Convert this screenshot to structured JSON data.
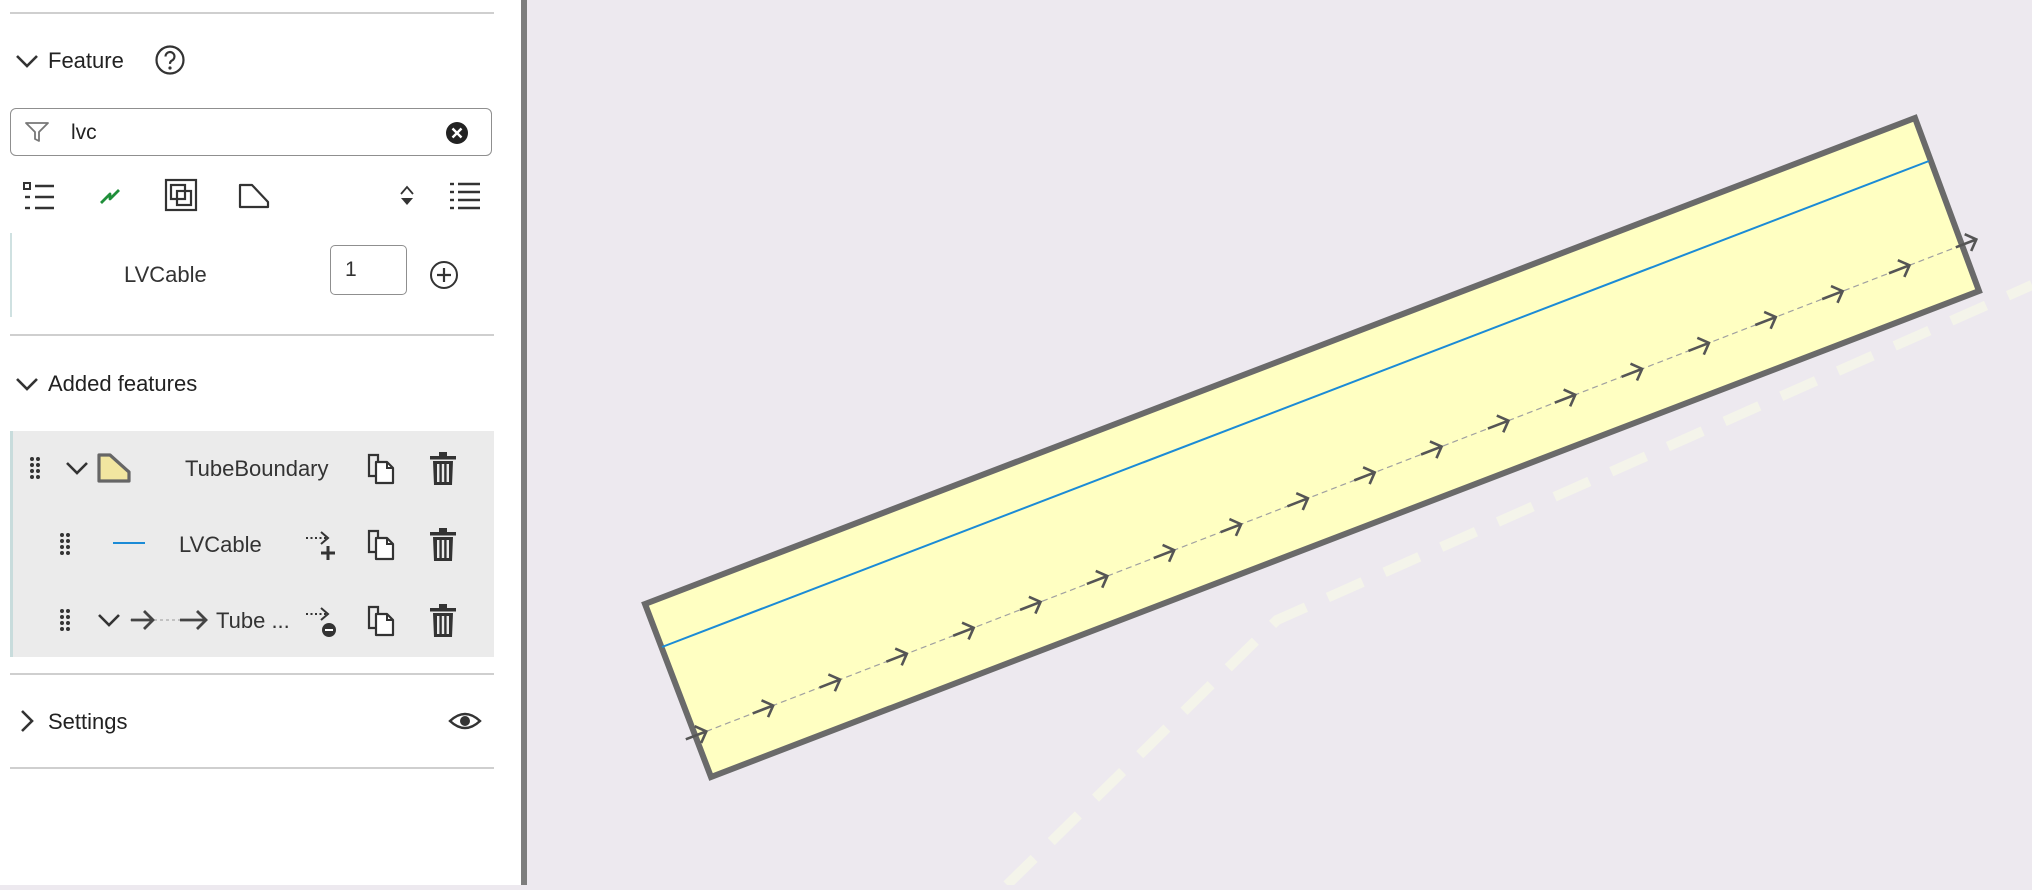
{
  "feature_section": {
    "title": "Feature"
  },
  "search": {
    "value": "lvc",
    "placeholder": ""
  },
  "feature_list": [
    {
      "name": "LVCable",
      "count": "1"
    }
  ],
  "added_section": {
    "title": "Added features"
  },
  "added_features": [
    {
      "label": "TubeBoundary",
      "level": 0
    },
    {
      "label": "LVCable",
      "level": 1
    },
    {
      "label": "Tube ...",
      "level": 1
    }
  ],
  "settings_section": {
    "title": "Settings"
  },
  "colors": {
    "polygon_fill": "#ffffc2",
    "polygon_stroke": "#6a6a6a",
    "cable_line": "#1b8bd6",
    "map_background": "#ede9ef",
    "line_tool_accent": "#1f8f3a"
  },
  "icons": [
    "chevron-down-icon",
    "help-icon",
    "filter-icon",
    "clear-icon",
    "list-icon",
    "line-tool-icon",
    "overlap-icon",
    "polygon-icon",
    "sort-icon",
    "details-list-icon",
    "add-circle-icon",
    "drag-handle-icon",
    "copy-icon",
    "trash-icon",
    "add-to-line-icon",
    "remove-from-line-icon",
    "chevron-right-icon",
    "eye-icon"
  ]
}
